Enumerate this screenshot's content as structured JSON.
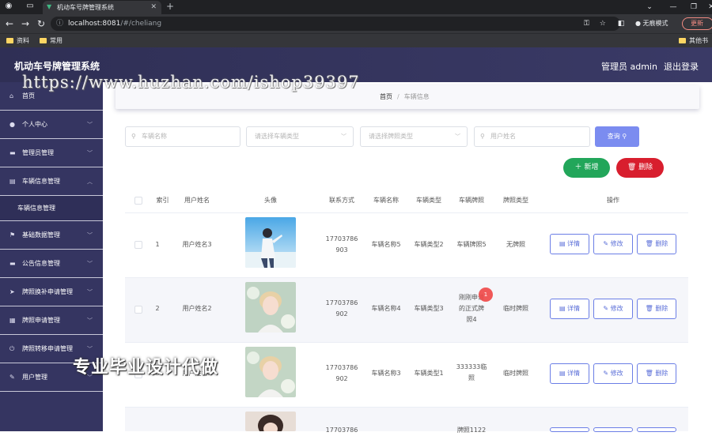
{
  "browser": {
    "tab_title": "机动车号牌管理系统",
    "url_host": "localhost:8081",
    "url_path": "/#/cheliang",
    "incognito_label": "无痕模式",
    "update_label": "更新",
    "bookmarks": [
      "资料",
      "常用"
    ],
    "bookmark_right": "其他书签"
  },
  "header": {
    "title": "机动车号牌管理系统",
    "admin_label": "管理员 admin",
    "logout_label": "退出登录"
  },
  "sidebar": {
    "items": [
      {
        "label": "首页",
        "icon": "home-icon"
      },
      {
        "label": "个人中心",
        "icon": "user-icon"
      },
      {
        "label": "管理员管理",
        "icon": "monitor-icon"
      },
      {
        "label": "车辆信息管理",
        "icon": "chat-icon"
      },
      {
        "label": "基础数据管理",
        "icon": "flag-icon"
      },
      {
        "label": "公告信息管理",
        "icon": "monitor-icon"
      },
      {
        "label": "牌照换补申请管理",
        "icon": "send-icon"
      },
      {
        "label": "牌照申请管理",
        "icon": "calendar-icon"
      },
      {
        "label": "牌照转移申请管理",
        "icon": "power-icon"
      },
      {
        "label": "用户管理",
        "icon": "pen-icon"
      }
    ],
    "subitem": "车辆信息管理"
  },
  "breadcrumb": {
    "home": "首页",
    "separator": "/",
    "current": "车辆信息"
  },
  "search": {
    "vehicle_name_placeholder": "车辆名称",
    "vehicle_type_placeholder": "请选择车辆类型",
    "plate_type_placeholder": "请选择牌照类型",
    "user_name_placeholder": "用户姓名",
    "query_label": "查询"
  },
  "actions": {
    "add_label": "新增",
    "delete_label": "删除"
  },
  "table": {
    "headers": [
      "索引",
      "用户姓名",
      "头像",
      "联系方式",
      "车辆名称",
      "车辆类型",
      "车辆牌照",
      "牌照类型",
      "操作"
    ],
    "rows": [
      {
        "index": "1",
        "user": "用户姓名3",
        "phone_1": "17703786",
        "phone_2": "903",
        "vehicle": "车辆名称5",
        "type": "车辆类型2",
        "plate_1": "车辆牌照5",
        "plate_2": "",
        "plate_3": "",
        "plate_type": "无牌照"
      },
      {
        "index": "2",
        "user": "用户姓名2",
        "phone_1": "17703786",
        "phone_2": "902",
        "vehicle": "车辆名称4",
        "type": "车辆类型3",
        "plate_1": "刚刚申请",
        "plate_2": "的正式牌",
        "plate_3": "照4",
        "plate_type": "临时牌照"
      },
      {
        "index": "3",
        "user": "用户姓名2",
        "phone_1": "17703786",
        "phone_2": "902",
        "vehicle": "车辆名称3",
        "type": "车辆类型1",
        "plate_1": "333333临",
        "plate_2": "照",
        "plate_3": "",
        "plate_type": "临时牌照"
      },
      {
        "index": "",
        "user": "",
        "phone_1": "17703786",
        "phone_2": "",
        "vehicle": "",
        "type": "",
        "plate_1": "牌照1122",
        "plate_2": "",
        "plate_3": "",
        "plate_type": ""
      }
    ],
    "op_detail": "详情",
    "op_edit": "修改",
    "op_delete": "删除"
  },
  "red_dot_label": "1",
  "watermark_url": "https://www.huzhan.com/ishop39397",
  "watermark_cn": "专业毕业设计代做",
  "colors": {
    "sidebar": "#353561",
    "header": "#2f2f55",
    "primary": "#7b8cf0",
    "success": "#22a65a",
    "danger": "#d81e2e"
  }
}
